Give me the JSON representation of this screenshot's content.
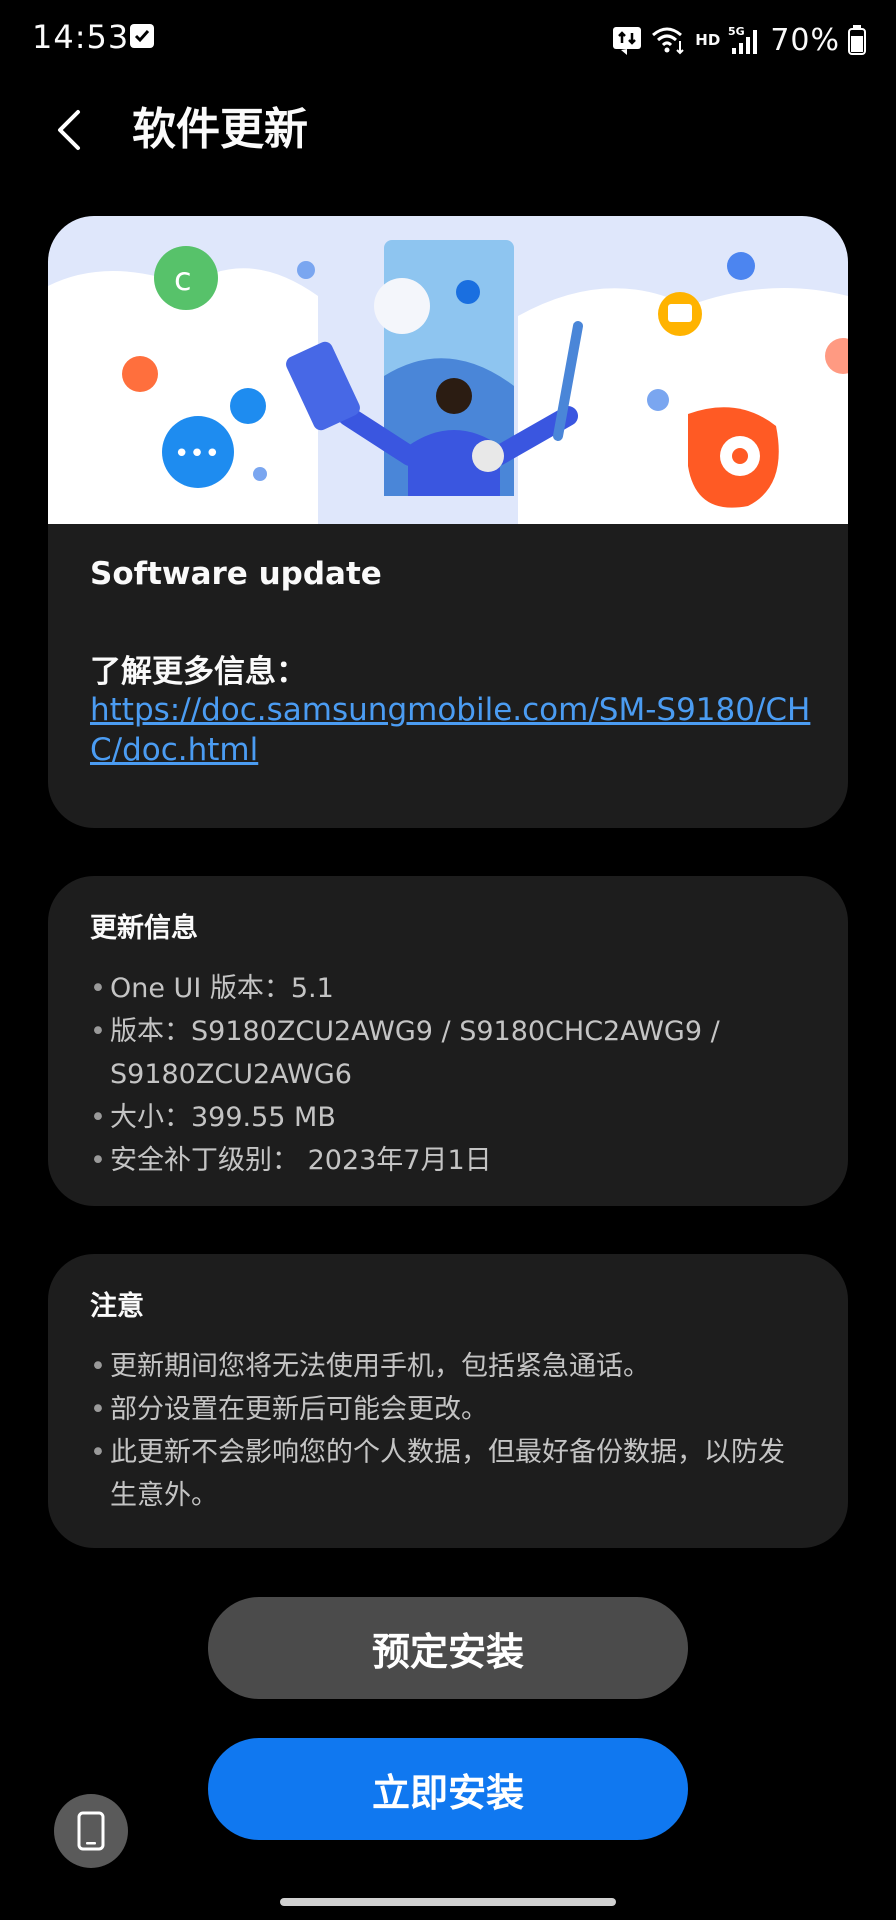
{
  "status_bar": {
    "time": "14:53",
    "network_hd": "HD",
    "network_5g": "5G",
    "battery": "70%"
  },
  "header": {
    "title": "软件更新"
  },
  "hero": {
    "title": "Software update",
    "learn_more": "了解更多信息：",
    "link": "https://doc.samsungmobile.com/SM-S9180/CHC/doc.html"
  },
  "update_info": {
    "heading": "更新信息",
    "items": [
      "One UI 版本：5.1",
      "版本：S9180ZCU2AWG9 / S9180CHC2AWG9 / S9180ZCU2AWG6",
      "大小：399.55 MB",
      "安全补丁级别： 2023年7月1日"
    ]
  },
  "notice": {
    "heading": "注意",
    "items": [
      "更新期间您将无法使用手机，包括紧急通话。",
      "部分设置在更新后可能会更改。",
      "此更新不会影响您的个人数据，但最好备份数据，以防发生意外。"
    ]
  },
  "buttons": {
    "schedule": "预定安装",
    "install_now": "立即安装"
  },
  "colors": {
    "accent": "#1078f0",
    "link": "#4b9cf2",
    "card": "#1d1d1d",
    "secondary_button": "#4b4b4b"
  }
}
